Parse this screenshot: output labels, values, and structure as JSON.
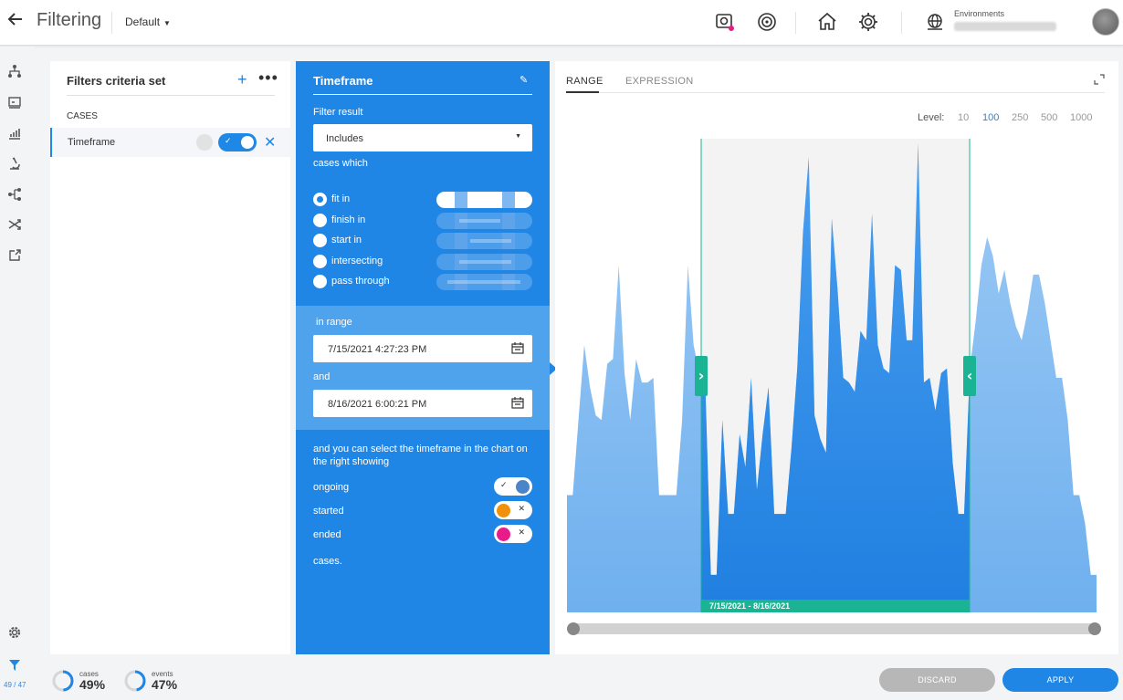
{
  "header": {
    "title": "Filtering",
    "preset": "Default",
    "environments_label": "Environments",
    "environment_value": ""
  },
  "rail": {
    "count": "49 / 47"
  },
  "criteria": {
    "title": "Filters criteria set",
    "section": "CASES",
    "items": [
      {
        "label": "Timeframe",
        "enabled": true
      }
    ]
  },
  "timeframe": {
    "title": "Timeframe",
    "filter_result_label": "Filter result",
    "filter_result_value": "Includes",
    "cases_which": "cases which",
    "options": [
      {
        "label": "fit in",
        "selected": true
      },
      {
        "label": "finish in",
        "selected": false
      },
      {
        "label": "start in",
        "selected": false
      },
      {
        "label": "intersecting",
        "selected": false
      },
      {
        "label": "pass through",
        "selected": false
      }
    ],
    "in_range_label": "in range",
    "start": "7/15/2021 4:27:23 PM",
    "and_label": "and",
    "end": "8/16/2021 6:00:21 PM",
    "paragraph": "and you can select the timeframe in the chart on the right showing",
    "switches": [
      {
        "label": "ongoing",
        "on": true,
        "color": "#4a84c9"
      },
      {
        "label": "started",
        "on": false,
        "color": "#f0900c"
      },
      {
        "label": "ended",
        "on": false,
        "color": "#e81c88"
      }
    ],
    "cases_suffix": "cases."
  },
  "chart_panel": {
    "tabs": [
      "RANGE",
      "EXPRESSION"
    ],
    "active_tab": "RANGE",
    "level_label": "Level:",
    "levels": [
      "10",
      "100",
      "250",
      "500",
      "1000"
    ],
    "selected_level": "100",
    "range_label": "7/15/2021 - 8/16/2021"
  },
  "chart_data": {
    "type": "area",
    "title": "",
    "xlabel": "",
    "ylabel": "",
    "values": [
      0.25,
      0.25,
      0.41,
      0.57,
      0.48,
      0.42,
      0.41,
      0.53,
      0.54,
      0.74,
      0.51,
      0.41,
      0.54,
      0.49,
      0.49,
      0.5,
      0.25,
      0.25,
      0.25,
      0.25,
      0.41,
      0.74,
      0.57,
      0.51,
      0.5,
      0.08,
      0.08,
      0.41,
      0.21,
      0.21,
      0.38,
      0.31,
      0.5,
      0.26,
      0.38,
      0.48,
      0.21,
      0.21,
      0.21,
      0.35,
      0.52,
      0.81,
      0.97,
      0.42,
      0.37,
      0.34,
      0.84,
      0.69,
      0.5,
      0.49,
      0.47,
      0.6,
      0.58,
      0.85,
      0.57,
      0.52,
      0.51,
      0.74,
      0.73,
      0.58,
      0.58,
      1.0,
      0.49,
      0.5,
      0.43,
      0.51,
      0.52,
      0.32,
      0.21,
      0.21,
      0.52,
      0.62,
      0.74,
      0.8,
      0.76,
      0.68,
      0.73,
      0.66,
      0.61,
      0.58,
      0.64,
      0.72,
      0.72,
      0.66,
      0.58,
      0.5,
      0.5,
      0.41,
      0.25,
      0.25,
      0.19,
      0.08,
      0.08
    ],
    "selected_range": [
      "7/15/2021",
      "8/16/2021"
    ],
    "series_color": "#2e8ae6",
    "selection_color": "#1ab394"
  },
  "footer": {
    "cases_label": "cases",
    "cases_value": "49%",
    "cases_fraction": 0.49,
    "events_label": "events",
    "events_value": "47%",
    "events_fraction": 0.47,
    "discard_label": "DISCARD",
    "apply_label": "APPLY"
  }
}
